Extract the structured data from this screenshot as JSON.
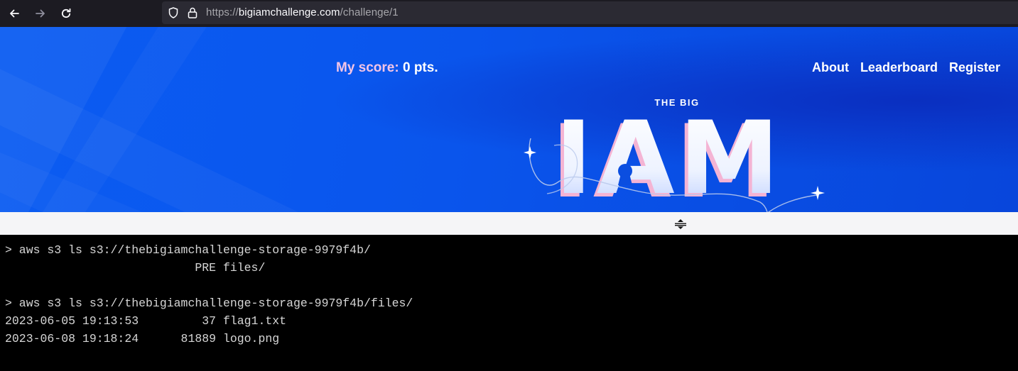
{
  "browser": {
    "back_icon": "arrow-left-icon",
    "forward_icon": "arrow-right-icon",
    "reload_icon": "reload-icon",
    "url_scheme": "https://",
    "url_host": "bigiamchallenge.com",
    "url_path": "/challenge/1"
  },
  "header": {
    "score_label": "My score:",
    "score_value": " 0 pts.",
    "nav": [
      "About",
      "Leaderboard",
      "Register"
    ]
  },
  "logo": {
    "top_text": "THE BIG",
    "main_text": "IAM"
  },
  "terminal": {
    "lines": [
      "> aws s3 ls s3://thebigiamchallenge-storage-9979f4b/",
      "                           PRE files/",
      "",
      "> aws s3 ls s3://thebigiamchallenge-storage-9979f4b/files/",
      "2023-06-05 19:13:53         37 flag1.txt",
      "2023-06-08 19:18:24      81889 logo.png"
    ]
  },
  "colors": {
    "hero_blue": "#0b5cf2",
    "score_label_pink": "#f2c4e6",
    "terminal_bg": "#000000",
    "terminal_text": "#d6d6d6"
  }
}
